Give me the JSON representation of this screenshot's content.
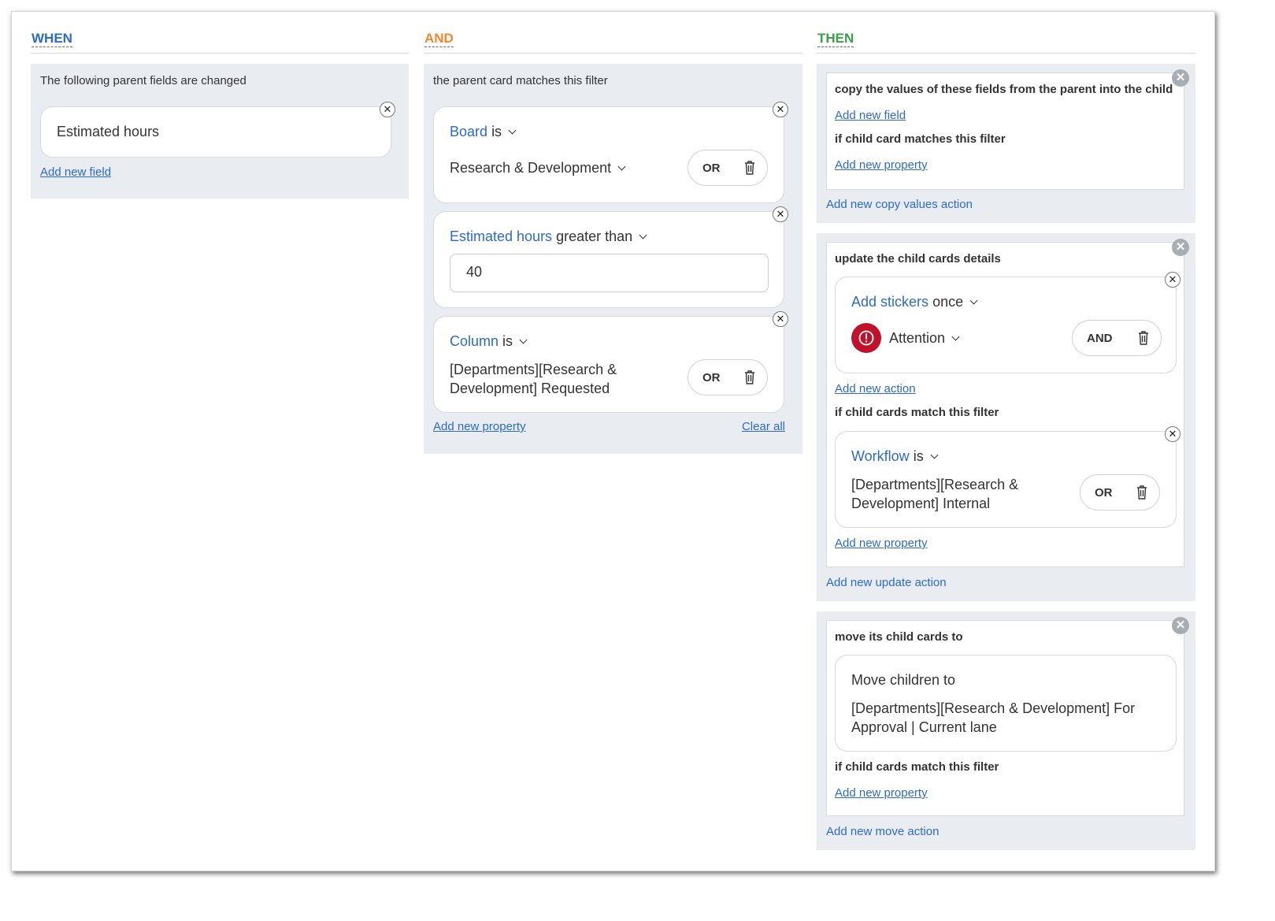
{
  "when": {
    "heading": "WHEN",
    "panel_title": "The following parent fields are changed",
    "field": "Estimated hours",
    "add_field": "Add new field"
  },
  "and": {
    "heading": "AND",
    "panel_title": "the parent card matches this filter",
    "board": {
      "name": "Board",
      "op": "is",
      "value": "Research & Development",
      "bool": "OR"
    },
    "hours": {
      "name": "Estimated hours",
      "op": "greater than",
      "value": "40"
    },
    "column": {
      "name": "Column",
      "op": "is",
      "value_line1": "[Departments][Research &",
      "value_line2": "Development] Requested",
      "bool": "OR"
    },
    "add_property": "Add new property",
    "clear_all": "Clear all"
  },
  "then": {
    "heading": "THEN",
    "copy": {
      "title": "copy the values of these fields from the parent into the child",
      "add_field": "Add new field",
      "filter_title": "if child card matches this filter",
      "add_property": "Add new property",
      "add_action": "Add new copy values action"
    },
    "update": {
      "title": "update the child cards details",
      "action_name": "Add stickers",
      "action_op": "once",
      "sticker": "Attention",
      "bool": "AND",
      "add_action": "Add new action",
      "filter_title": "if child cards match this filter",
      "workflow_name": "Workflow",
      "workflow_op": "is",
      "workflow_line1": "[Departments][Research &",
      "workflow_line2": "Development] Internal",
      "workflow_bool": "OR",
      "add_property": "Add new property",
      "add_update": "Add new update action"
    },
    "move": {
      "title": "move its child cards to",
      "label": "Move children to",
      "target_line1": "[Departments][Research & Development] For",
      "target_line2": "Approval | Current lane",
      "filter_title": "if child cards match this filter",
      "add_property": "Add new property",
      "add_move": "Add new move action"
    }
  },
  "colors": {
    "when": "#2d6ac7",
    "and": "#ef8a2c",
    "then": "#3aa046",
    "link": "#2d6ac7",
    "sticker": "#c0122a"
  },
  "icons": [
    "close-icon",
    "chevron-down-icon",
    "trash-icon",
    "exclamation-circle-icon"
  ]
}
